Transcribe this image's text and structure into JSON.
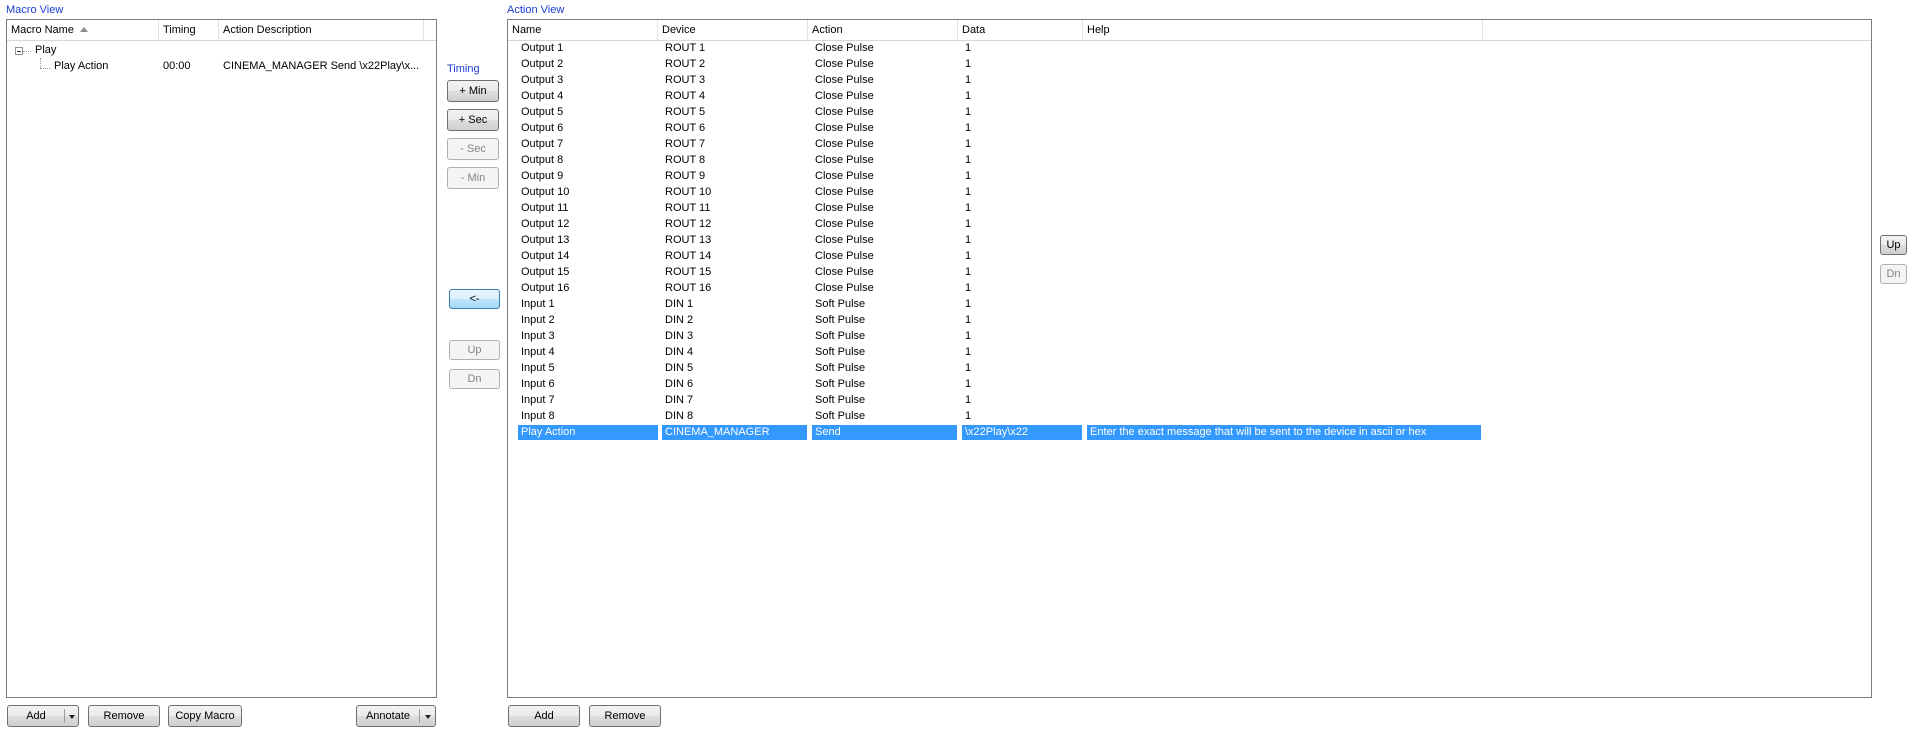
{
  "macro_view": {
    "title": "Macro View",
    "columns": {
      "name": "Macro Name",
      "timing": "Timing",
      "description": "Action Description"
    },
    "tree": {
      "root_label": "Play",
      "child": {
        "name": "Play Action",
        "timing": "00:00",
        "description": "CINEMA_MANAGER Send \\x22Play\\x..."
      }
    },
    "buttons": {
      "add": "Add",
      "remove": "Remove",
      "copy": "Copy Macro",
      "annotate": "Annotate"
    }
  },
  "timing": {
    "title": "Timing",
    "plus_min": "+ Min",
    "plus_sec": "+ Sec",
    "minus_sec": "- Sec",
    "minus_min": "- Min",
    "move_left": "<-",
    "up": "Up",
    "dn": "Dn"
  },
  "action_view": {
    "title": "Action View",
    "columns": {
      "name": "Name",
      "device": "Device",
      "action": "Action",
      "data": "Data",
      "help": "Help"
    },
    "rows": [
      {
        "name": "Output 1",
        "device": "ROUT 1",
        "action": "Close Pulse",
        "data": "1",
        "help": ""
      },
      {
        "name": "Output 2",
        "device": "ROUT 2",
        "action": "Close Pulse",
        "data": "1",
        "help": ""
      },
      {
        "name": "Output 3",
        "device": "ROUT 3",
        "action": "Close Pulse",
        "data": "1",
        "help": ""
      },
      {
        "name": "Output 4",
        "device": "ROUT 4",
        "action": "Close Pulse",
        "data": "1",
        "help": ""
      },
      {
        "name": "Output 5",
        "device": "ROUT 5",
        "action": "Close Pulse",
        "data": "1",
        "help": ""
      },
      {
        "name": "Output 6",
        "device": "ROUT 6",
        "action": "Close Pulse",
        "data": "1",
        "help": ""
      },
      {
        "name": "Output 7",
        "device": "ROUT 7",
        "action": "Close Pulse",
        "data": "1",
        "help": ""
      },
      {
        "name": "Output 8",
        "device": "ROUT 8",
        "action": "Close Pulse",
        "data": "1",
        "help": ""
      },
      {
        "name": "Output 9",
        "device": "ROUT 9",
        "action": "Close Pulse",
        "data": "1",
        "help": ""
      },
      {
        "name": "Output 10",
        "device": "ROUT 10",
        "action": "Close Pulse",
        "data": "1",
        "help": ""
      },
      {
        "name": "Output 11",
        "device": "ROUT 11",
        "action": "Close Pulse",
        "data": "1",
        "help": ""
      },
      {
        "name": "Output 12",
        "device": "ROUT 12",
        "action": "Close Pulse",
        "data": "1",
        "help": ""
      },
      {
        "name": "Output 13",
        "device": "ROUT 13",
        "action": "Close Pulse",
        "data": "1",
        "help": ""
      },
      {
        "name": "Output 14",
        "device": "ROUT 14",
        "action": "Close Pulse",
        "data": "1",
        "help": ""
      },
      {
        "name": "Output 15",
        "device": "ROUT 15",
        "action": "Close Pulse",
        "data": "1",
        "help": ""
      },
      {
        "name": "Output 16",
        "device": "ROUT 16",
        "action": "Close Pulse",
        "data": "1",
        "help": ""
      },
      {
        "name": "Input 1",
        "device": "DIN 1",
        "action": "Soft Pulse",
        "data": "1",
        "help": ""
      },
      {
        "name": "Input 2",
        "device": "DIN 2",
        "action": "Soft Pulse",
        "data": "1",
        "help": ""
      },
      {
        "name": "Input 3",
        "device": "DIN 3",
        "action": "Soft Pulse",
        "data": "1",
        "help": ""
      },
      {
        "name": "Input 4",
        "device": "DIN 4",
        "action": "Soft Pulse",
        "data": "1",
        "help": ""
      },
      {
        "name": "Input 5",
        "device": "DIN 5",
        "action": "Soft Pulse",
        "data": "1",
        "help": ""
      },
      {
        "name": "Input 6",
        "device": "DIN 6",
        "action": "Soft Pulse",
        "data": "1",
        "help": ""
      },
      {
        "name": "Input 7",
        "device": "DIN 7",
        "action": "Soft Pulse",
        "data": "1",
        "help": ""
      },
      {
        "name": "Input 8",
        "device": "DIN 8",
        "action": "Soft Pulse",
        "data": "1",
        "help": ""
      },
      {
        "name": "Play Action",
        "device": "CINEMA_MANAGER",
        "action": "Send",
        "data": "\\x22Play\\x22",
        "help": "Enter the exact message that will be sent to the device in ascii or hex",
        "selected": true
      }
    ],
    "buttons": {
      "add": "Add",
      "remove": "Remove"
    }
  },
  "right_buttons": {
    "up": "Up",
    "dn": "Dn"
  },
  "colors": {
    "title_blue": "#1a3cd1",
    "selection": "#3399ff"
  }
}
